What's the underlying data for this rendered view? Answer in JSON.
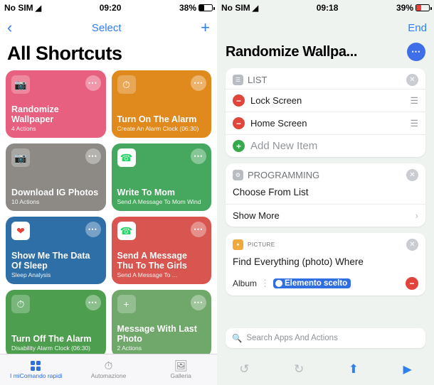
{
  "left": {
    "status": {
      "carrier": "No SIM",
      "wifi_icon": "wifi-icon",
      "time": "09:20",
      "battery": "38%"
    },
    "nav": {
      "back_icon": "chevron-left-icon",
      "select_label": "Select",
      "add_icon": "plus-icon"
    },
    "title": "All Shortcuts",
    "cards": [
      {
        "title": "Randomize Wallpaper",
        "subtitle": "4 Actions",
        "icon": "photo-icon",
        "color": "#e8607f",
        "more_icon": "ellipsis-icon"
      },
      {
        "title": "Turn On The Alarm",
        "subtitle": "Create An Alarm Clock (06:30)",
        "icon": "clock-icon",
        "color": "#e08a1e",
        "more_icon": "ellipsis-icon"
      },
      {
        "title": "Download IG Photos",
        "subtitle": "10 Actions",
        "icon": "photo-icon",
        "color": "#8d8a85",
        "more_icon": "ellipsis-icon"
      },
      {
        "title": "Write To Mom",
        "subtitle": "Send A Message To Mom Wind",
        "icon": "whatsapp-icon",
        "color": "#46a85e",
        "more_icon": "ellipsis-icon"
      },
      {
        "title": "Show Me The Data Of Sleep",
        "subtitle": "Sleep Analysis",
        "icon": "heart-icon",
        "color": "#2f6fa8",
        "more_icon": "ellipsis-icon"
      },
      {
        "title": "Send A Message Thu To The Girls",
        "subtitle": "Send A Message To ...",
        "icon": "whatsapp-icon",
        "color": "#d9554f",
        "more_icon": "ellipsis-icon"
      },
      {
        "title": "Turn Off The Alarm",
        "subtitle": "Disability Alarm Clock (06:30)",
        "icon": "clock-icon",
        "color": "#4d9e4f",
        "more_icon": "ellipsis-icon"
      },
      {
        "title": "Message With Last Photo",
        "subtitle": "2 Actions",
        "icon": "plus-circle-icon",
        "color": "#6fa86a",
        "more_icon": "ellipsis-icon"
      }
    ],
    "tabs": [
      {
        "label": "I miComando rapidi",
        "icon": "squares-grid-icon",
        "active": true
      },
      {
        "label": "Automazione",
        "icon": "automation-icon",
        "active": false
      },
      {
        "label": "Galleria",
        "icon": "gallery-icon",
        "active": false
      }
    ]
  },
  "right": {
    "status": {
      "carrier": "No SIM",
      "wifi_icon": "wifi-icon",
      "time": "09:18",
      "battery": "39%"
    },
    "nav": {
      "end_label": "End"
    },
    "title": "Randomize Wallpa...",
    "more_icon": "ellipsis-icon",
    "blocks": [
      {
        "kind": "list",
        "name": "LIST",
        "icon": "list-icon",
        "close_icon": "close-icon",
        "items": [
          {
            "label": "Lock Screen",
            "remove_icon": "minus-icon",
            "drag_icon": "drag-handle-icon"
          },
          {
            "label": "Home Screen",
            "remove_icon": "minus-icon",
            "drag_icon": "drag-handle-icon"
          }
        ],
        "add_label": "Add New Item",
        "add_icon": "plus-icon"
      },
      {
        "kind": "programming",
        "name": "PROGRAMMING",
        "icon": "gear-icon",
        "close_icon": "close-icon",
        "body": "Choose From List",
        "show_more_label": "Show More",
        "chevron_icon": "chevron-right-icon"
      },
      {
        "kind": "picture",
        "name": "PICTURE",
        "icon": "photo-icon",
        "close_icon": "close-icon",
        "body": "Find Everything (photo) Where",
        "album_label": "Album",
        "album_chain_icon": "link-icon",
        "chip_label": "Elemento scelto",
        "chip_icon": "variable-icon",
        "remove_icon": "minus-icon"
      }
    ],
    "search": {
      "placeholder": "Search Apps And Actions",
      "icon": "search-icon"
    },
    "toolbar": [
      {
        "name": "undo-button",
        "icon": "undo-icon",
        "enabled": false
      },
      {
        "name": "redo-button",
        "icon": "redo-icon",
        "enabled": false
      },
      {
        "name": "share-button",
        "icon": "share-icon",
        "enabled": true
      },
      {
        "name": "play-button",
        "icon": "play-icon",
        "enabled": true
      }
    ]
  }
}
